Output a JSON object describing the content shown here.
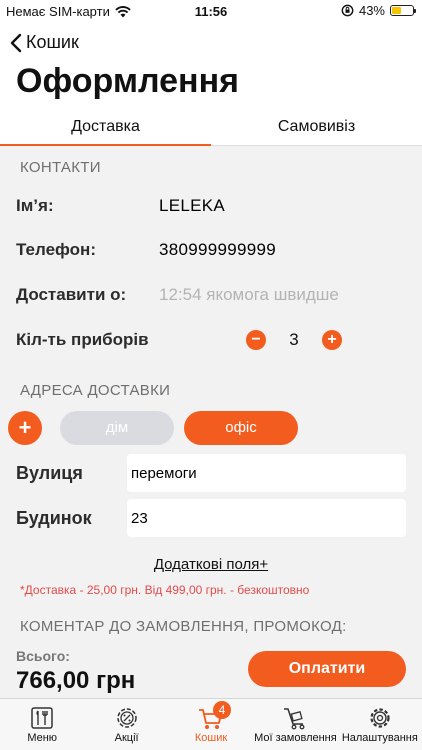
{
  "status_bar": {
    "carrier": "Немає SIM-карти",
    "time": "11:56",
    "battery": "43%",
    "battery_level": 0.43
  },
  "nav": {
    "back_label": "Кошик",
    "title": "Оформлення"
  },
  "tabs": [
    {
      "label": "Доставка",
      "active": true
    },
    {
      "label": "Самовивіз",
      "active": false
    }
  ],
  "contacts": {
    "section_title": "КОНТАКТИ",
    "name_label": "Ім’я:",
    "name_value": "LELEKA",
    "phone_label": "Телефон:",
    "phone_value": "380999999999",
    "deliver_label": "Доставити о:",
    "deliver_placeholder": "12:54 якомога швидше",
    "cutlery_label": "Кіл-ть приборів",
    "cutlery_minus": "−",
    "cutlery_value": "3",
    "cutlery_plus": "+"
  },
  "address": {
    "section_title": "АДРЕСА ДОСТАВКИ",
    "add_label": "+",
    "chips": [
      {
        "label": "дім",
        "active": false
      },
      {
        "label": "офіс",
        "active": true
      }
    ],
    "street_label": "Вулиця",
    "street_value": "перемоги",
    "house_label": "Будинок",
    "house_value": "23"
  },
  "extra_fields_link": "Додаткові поля+",
  "delivery_note": "*Доставка - 25,00 грн. Від 499,00 грн. - безкоштовно",
  "comment_title": "КОМЕНТАР ДО ЗАМОВЛЕННЯ, ПРОМОКОД:",
  "total": {
    "label": "Всього:",
    "value": "766,00 грн"
  },
  "pay_button": "Оплатити",
  "tabbar": [
    {
      "label": "Меню",
      "icon": "menu-book-icon"
    },
    {
      "label": "Акції",
      "icon": "promo-gear-icon"
    },
    {
      "label": "Кошик",
      "icon": "cart-icon",
      "active": true,
      "badge": "4"
    },
    {
      "label": "Мої замовлення",
      "icon": "orders-cart-icon"
    },
    {
      "label": "Налаштування",
      "icon": "settings-gear-icon"
    }
  ],
  "colors": {
    "accent": "#f25c1f",
    "background": "#f2f2f2",
    "chip_inactive": "#dadbe0",
    "note": "#e34b4b"
  }
}
